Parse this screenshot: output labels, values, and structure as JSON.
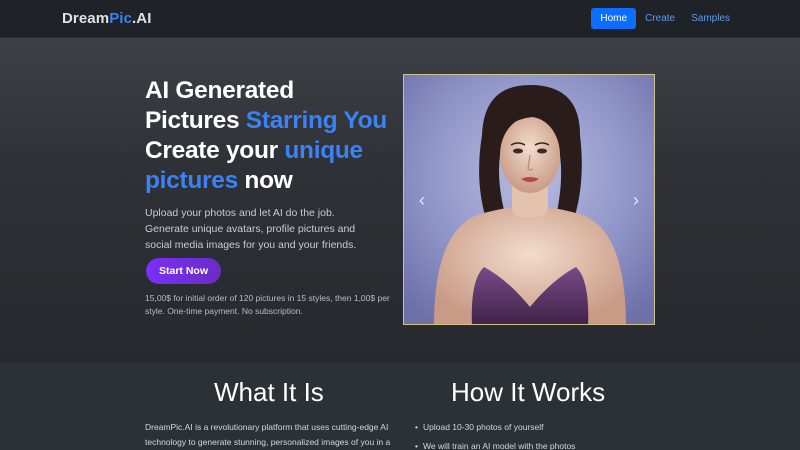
{
  "nav": {
    "brand_start": "Dream",
    "brand_accent": "Pic",
    "brand_end": ".AI",
    "links": [
      "Home",
      "Create",
      "Samples"
    ]
  },
  "hero": {
    "line1": "AI Generated",
    "line2_start": "Pictures ",
    "line2_hl": "Starring You",
    "line3_start": "Create your ",
    "line3_hl": "unique",
    "line4_hl": "pictures",
    "line4_end": " now",
    "lead": "Upload your photos and let AI do the job. Generate unique avatars, profile pictures and social media images for you and your friends.",
    "cta": "Start Now",
    "pricing": "15,00$ for initial order of 120 pictures in 15 styles, then 1,00$ per style. One-time payment. No subscription."
  },
  "carousel": {
    "prev_icon": "‹",
    "next_icon": "›",
    "image": "portrait-painting-woman"
  },
  "what_it_is": {
    "title": "What It Is",
    "text": "DreamPic.AI is a revolutionary platform that uses cutting-edge AI technology to generate stunning, personalized images of you in a variety of styles. Whether you want to see yourself as a celebrity"
  },
  "how_it_works": {
    "title": "How It Works",
    "steps": [
      "Upload 10-30 photos of yourself",
      "We will train an AI model with the photos"
    ]
  },
  "colors": {
    "accent": "#3b82f6",
    "primary": "#0d6efd",
    "cta_gradient_start": "#7b2ff7",
    "background": "#212529"
  }
}
